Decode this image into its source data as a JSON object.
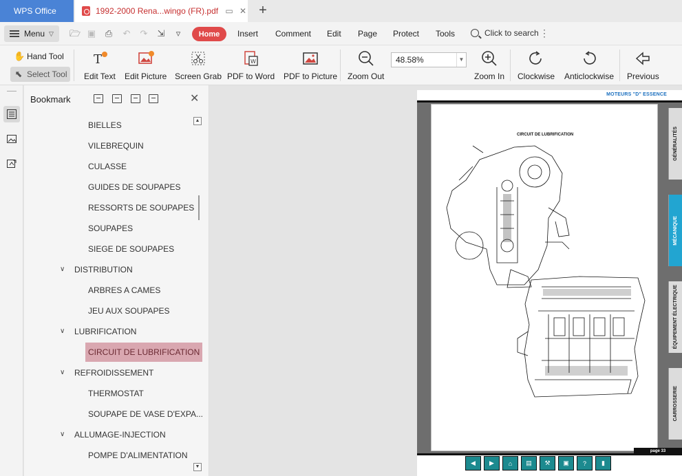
{
  "titlebar": {
    "app_tab": "WPS Office",
    "doc_tab": "1992-2000 Rena...wingo (FR).pdf"
  },
  "menubar": {
    "menu_label": "Menu",
    "tabs": [
      "Home",
      "Insert",
      "Comment",
      "Edit",
      "Page",
      "Protect",
      "Tools"
    ],
    "search_label": "Click to search"
  },
  "toolbar": {
    "hand_tool": "Hand Tool",
    "select_tool": "Select Tool",
    "edit_text": "Edit Text",
    "edit_picture": "Edit Picture",
    "screen_grab": "Screen Grab",
    "pdf_to_word": "PDF to Word",
    "pdf_to_picture": "PDF to Picture",
    "zoom_out": "Zoom Out",
    "zoom_value": "48.58%",
    "zoom_in": "Zoom In",
    "clockwise": "Clockwise",
    "anticlockwise": "Anticlockwise",
    "previous": "Previous"
  },
  "bookmark": {
    "title": "Bookmark",
    "items": [
      {
        "label": "BIELLES",
        "level": 2
      },
      {
        "label": "VILEBREQUIN",
        "level": 2
      },
      {
        "label": "CULASSE",
        "level": 2
      },
      {
        "label": "GUIDES DE SOUPAPES",
        "level": 2
      },
      {
        "label": "RESSORTS DE SOUPAPES",
        "level": 2
      },
      {
        "label": "SOUPAPES",
        "level": 2
      },
      {
        "label": "SIEGE DE SOUPAPES",
        "level": 2
      },
      {
        "label": "DISTRIBUTION",
        "level": 1
      },
      {
        "label": "ARBRES A CAMES",
        "level": 2
      },
      {
        "label": "JEU AUX SOUPAPES",
        "level": 2
      },
      {
        "label": "LUBRIFICATION",
        "level": 1
      },
      {
        "label": "CIRCUIT DE LUBRIFICATION",
        "level": 2,
        "selected": true
      },
      {
        "label": "REFROIDISSEMENT",
        "level": 1
      },
      {
        "label": "THERMOSTAT",
        "level": 2
      },
      {
        "label": "SOUPAPE DE VASE D'EXPA...",
        "level": 2
      },
      {
        "label": "ALLUMAGE-INJECTION",
        "level": 1
      },
      {
        "label": "POMPE D'ALIMENTATION",
        "level": 2
      }
    ]
  },
  "document": {
    "header": "MOTEURS \"D\" ESSENCE",
    "diagram_title": "CIRCUIT DE LUBRIFICATION",
    "side_tabs": [
      "GÉNÉRALITÉS",
      "MÉCANIQUE",
      "ÉQUIPEMENT ÉLECTRIQUE",
      "CARROSSERIE"
    ],
    "page_label": "page 33"
  },
  "colors": {
    "app_tab": "#4a83d6",
    "home_pill": "#e04a4a",
    "selected_bookmark": "#d9a7b0",
    "active_side_tab": "#22a5d1",
    "nav_buttons": "#1c8a8f"
  }
}
